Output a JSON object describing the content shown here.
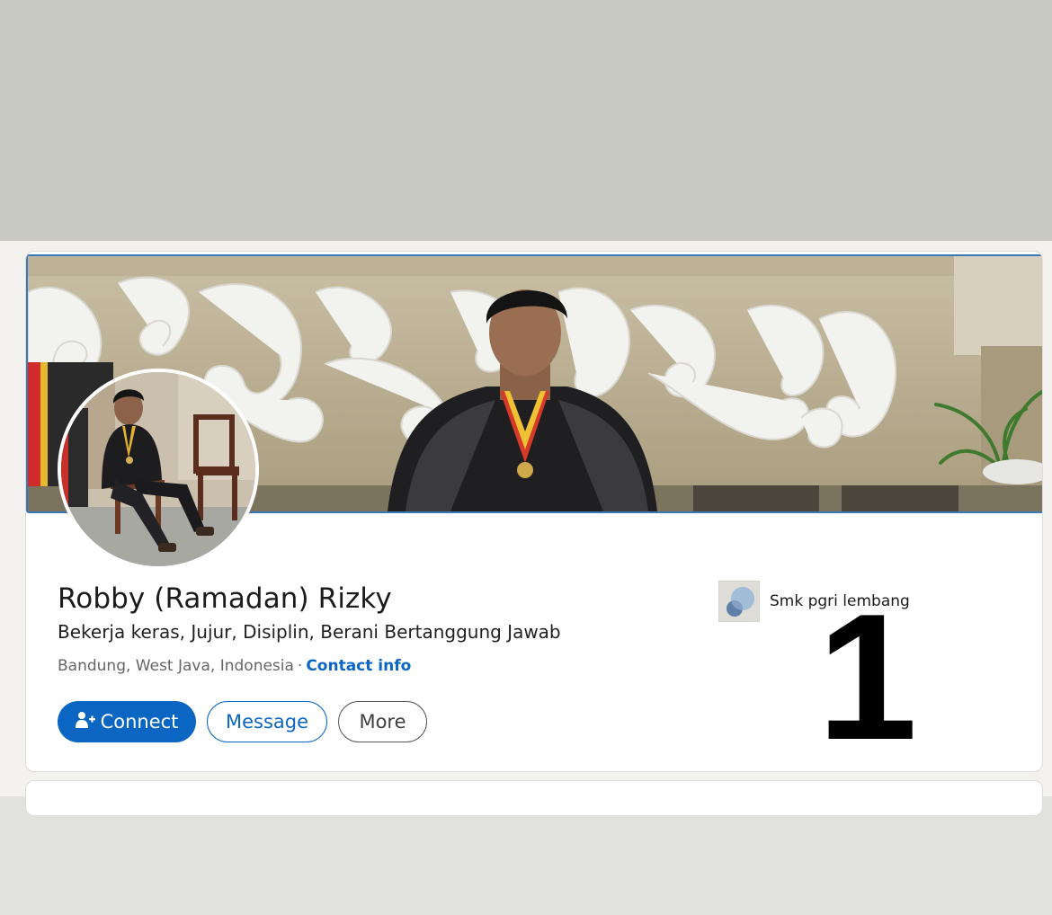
{
  "profile": {
    "name": "Robby (Ramadan) Rizky",
    "headline": "Bekerja keras, Jujur, Disiplin, Berani Bertanggung Jawab",
    "location": "Bandung, West Java, Indonesia",
    "separator": "·",
    "contact_info_label": "Contact info"
  },
  "actions": {
    "connect_label": "Connect",
    "message_label": "Message",
    "more_label": "More"
  },
  "education": {
    "school_name": "Smk pgri lembang"
  },
  "overlay": {
    "number": "1"
  },
  "icons": {
    "connect": "add-person-icon",
    "school_logo": "school-logo-placeholder-icon"
  },
  "colors": {
    "accent": "#0a66c2",
    "banner_border": "#3b78b5"
  }
}
